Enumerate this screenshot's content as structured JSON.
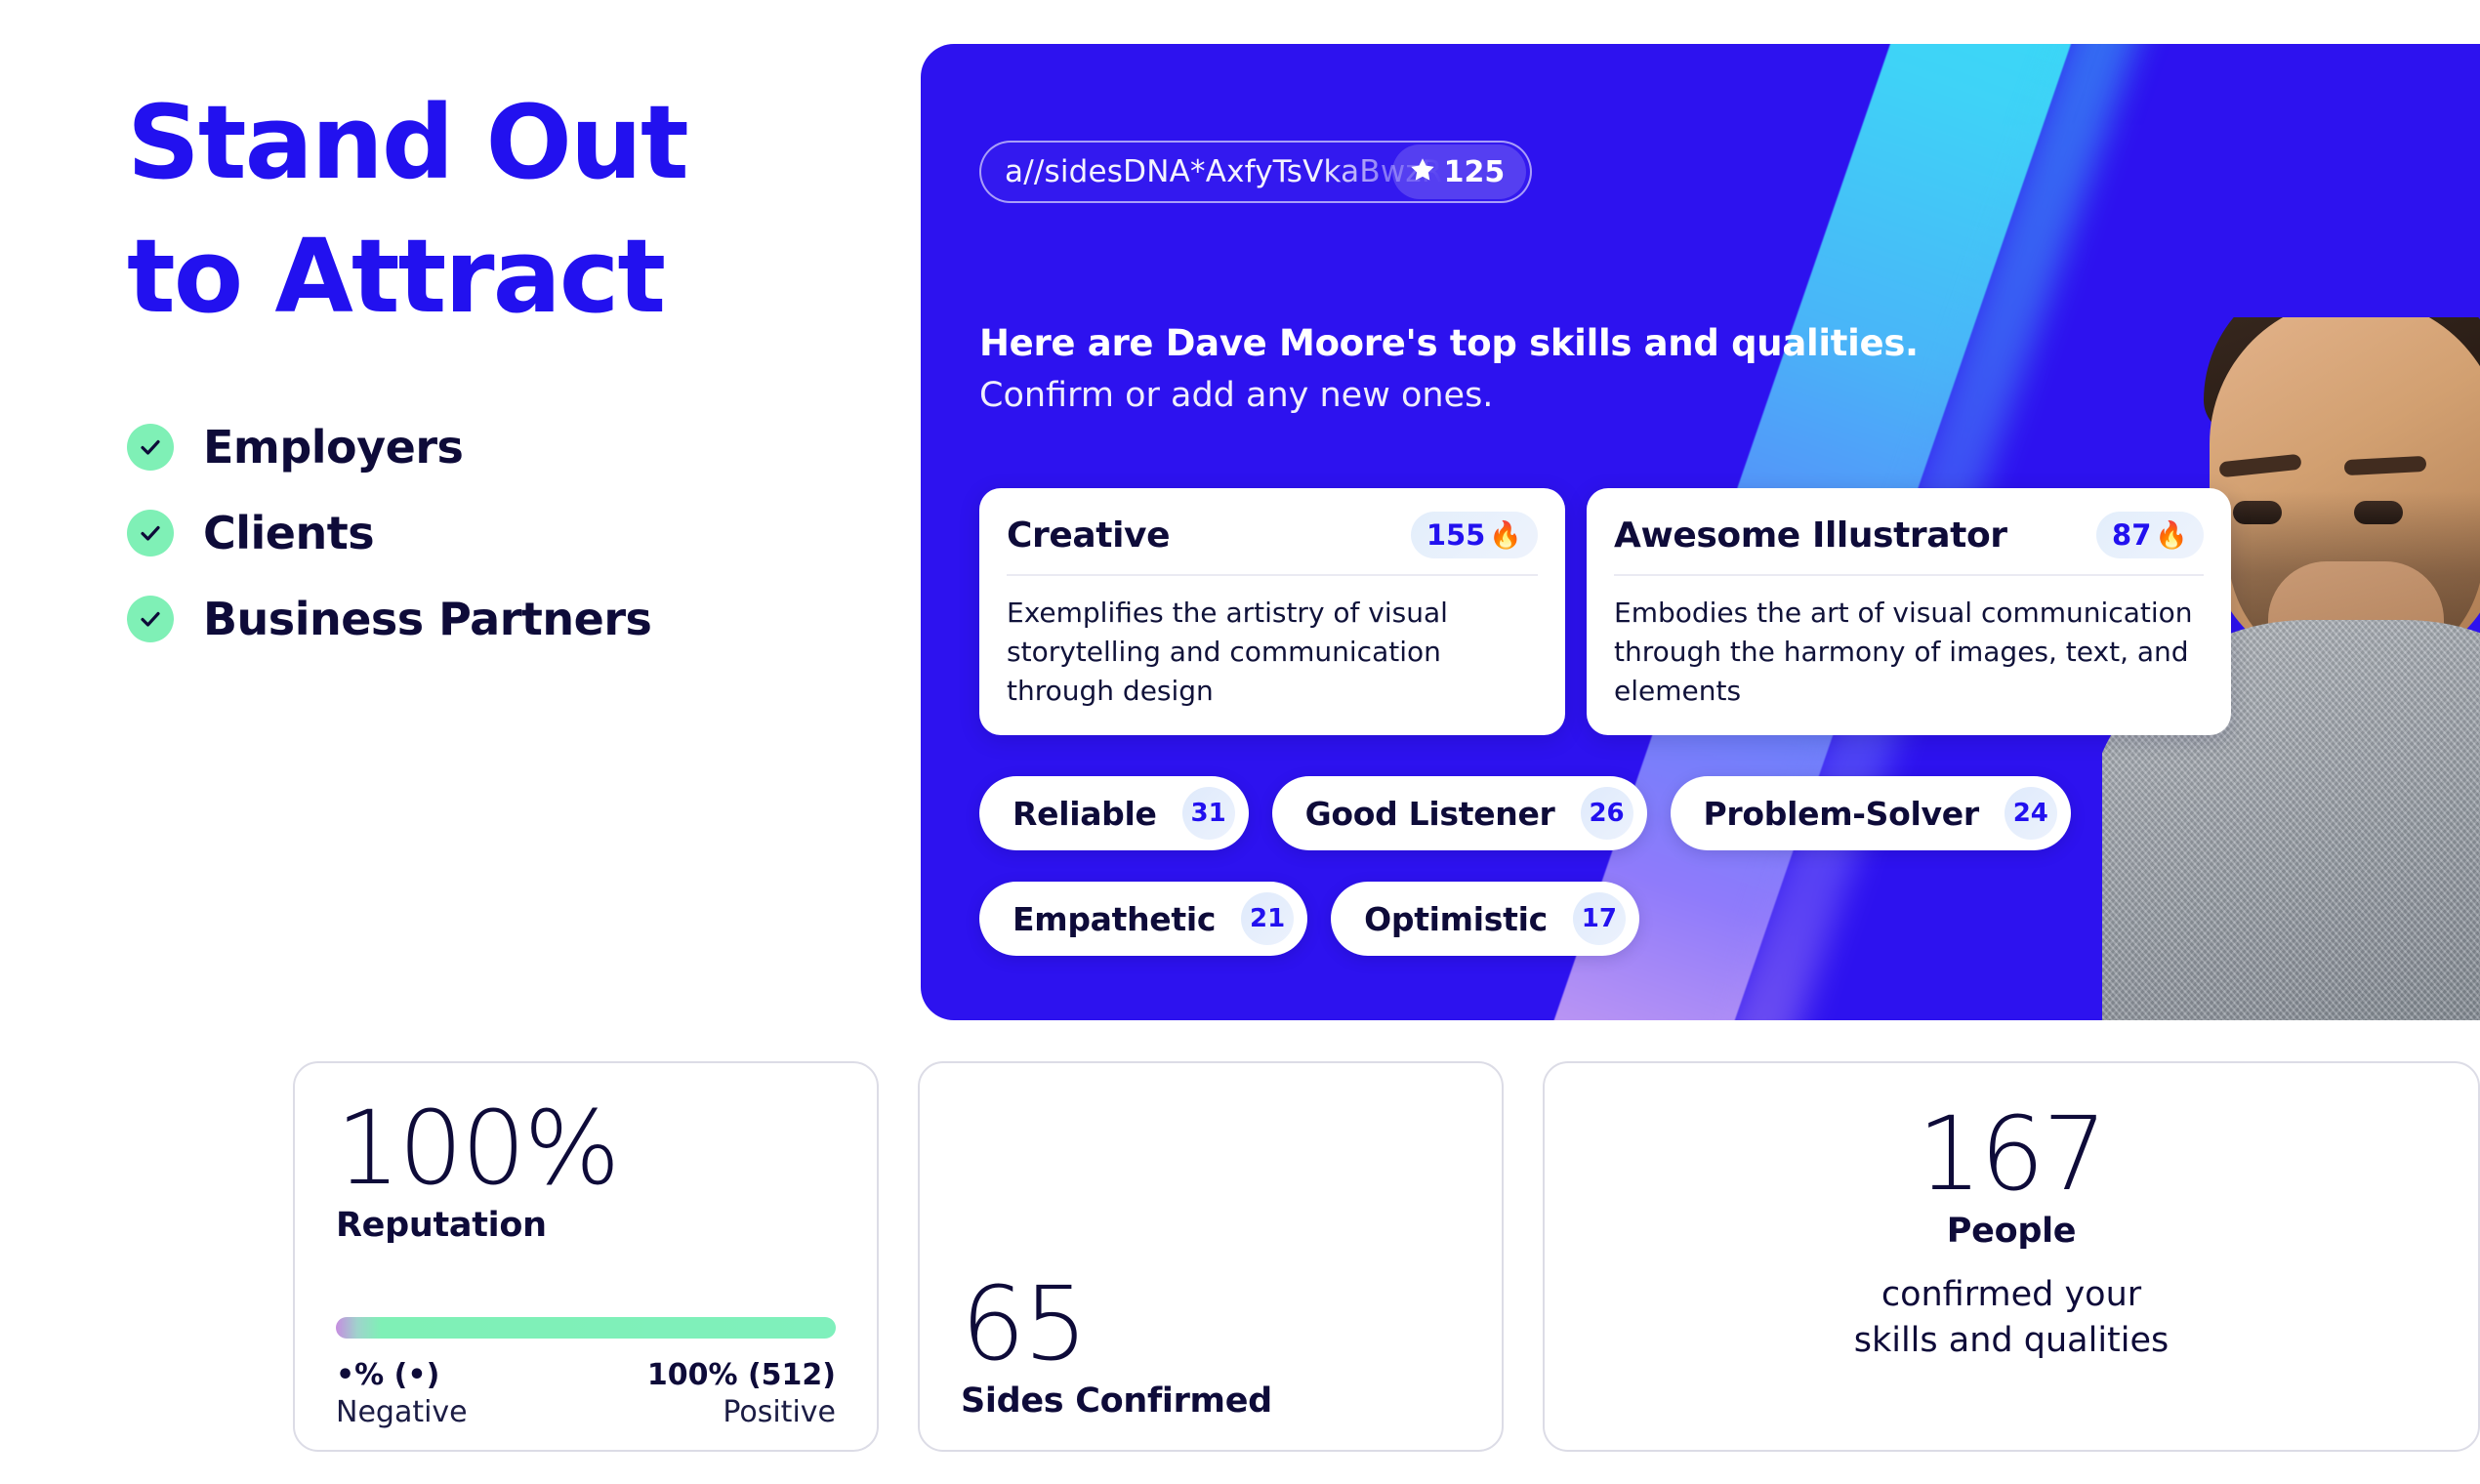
{
  "left": {
    "headline_lines": [
      "Stand Out",
      "to Attract"
    ],
    "headline_color": "#2211ef",
    "checklist": [
      {
        "label": "Employers",
        "icon": "check-icon"
      },
      {
        "label": "Clients",
        "icon": "check-icon"
      },
      {
        "label": "Business Partners",
        "icon": "check-icon"
      }
    ]
  },
  "hero": {
    "background_color": "#2d12ef",
    "url_pill": {
      "text": "a//sidesDNA*AxfyTsVkaBwzR",
      "star_icon": "star-icon",
      "star_count": "125"
    },
    "title": "Here are Dave Moore's top skills and qualities.",
    "subtitle": "Confirm or add any new ones.",
    "skill_cards": [
      {
        "name": "Creative",
        "count": "155",
        "emoji": "🔥",
        "description": "Exemplifies the artistry of visual storytelling and communication through design"
      },
      {
        "name": "Awesome Illustrator",
        "count": "87",
        "emoji": "🔥",
        "description": "Embodies the art of visual communication through the harmony of images, text, and elements"
      }
    ],
    "chips_row1": [
      {
        "label": "Reliable",
        "count": "31"
      },
      {
        "label": "Good Listener",
        "count": "26"
      },
      {
        "label": "Problem-Solver",
        "count": "24"
      }
    ],
    "chips_row2": [
      {
        "label": "Empathetic",
        "count": "21"
      },
      {
        "label": "Optimistic",
        "count": "17"
      }
    ],
    "photo_alt": "portrait-photo"
  },
  "stats": {
    "reputation": {
      "value": "100%",
      "label": "Reputation",
      "bar_color": "#7ff0bc",
      "negative_value": "•% (•)",
      "negative_label": "Negative",
      "positive_value": "100% (512)",
      "positive_label": "Positive"
    },
    "sides": {
      "value": "65",
      "label": "Sides Confirmed"
    },
    "people": {
      "value": "167",
      "label": "People",
      "note": "confirmed your\nskills and qualities"
    }
  }
}
